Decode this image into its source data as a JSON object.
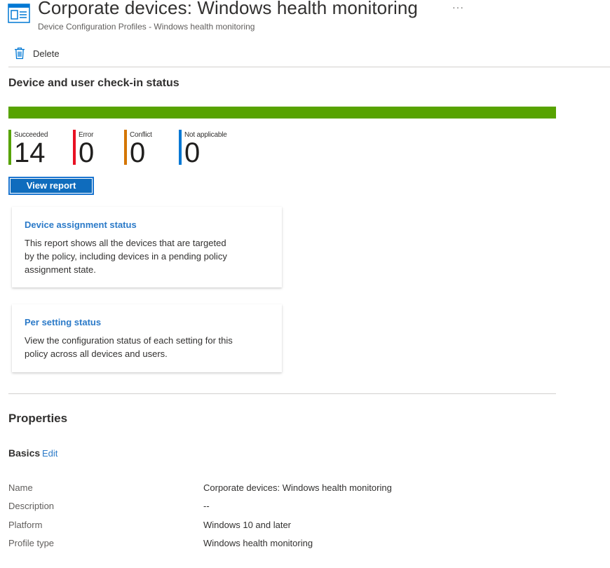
{
  "header": {
    "title": "Corporate devices: Windows health monitoring",
    "subtitle": "Device Configuration Profiles - Windows health monitoring",
    "more_label": "···",
    "icon": "profile-icon"
  },
  "toolbar": {
    "delete_label": "Delete",
    "delete_icon": "trash-icon"
  },
  "status": {
    "title": "Device and user check-in status",
    "progress_percent": 100,
    "colors": {
      "succeeded": "#57a300",
      "error": "#e81123",
      "conflict": "#d47500",
      "not_applicable": "#0078d4"
    },
    "stats": [
      {
        "label": "Succeeded",
        "value": "14"
      },
      {
        "label": "Error",
        "value": "0"
      },
      {
        "label": "Conflict",
        "value": "0"
      },
      {
        "label": "Not applicable",
        "value": "0"
      }
    ],
    "view_report_label": "View report"
  },
  "cards": [
    {
      "title": "Device assignment status",
      "description": "This report shows all the devices that are targeted by the policy, including devices in a pending policy assignment state."
    },
    {
      "title": "Per setting status",
      "description": "View the configuration status of each setting for this policy across all devices and users."
    }
  ],
  "properties": {
    "title": "Properties",
    "basics_label": "Basics",
    "edit_label": "Edit",
    "rows": [
      {
        "key": "Name",
        "value": "Corporate devices: Windows health monitoring"
      },
      {
        "key": "Description",
        "value": "--"
      },
      {
        "key": "Platform",
        "value": "Windows 10 and later"
      },
      {
        "key": "Profile type",
        "value": "Windows health monitoring"
      }
    ]
  }
}
